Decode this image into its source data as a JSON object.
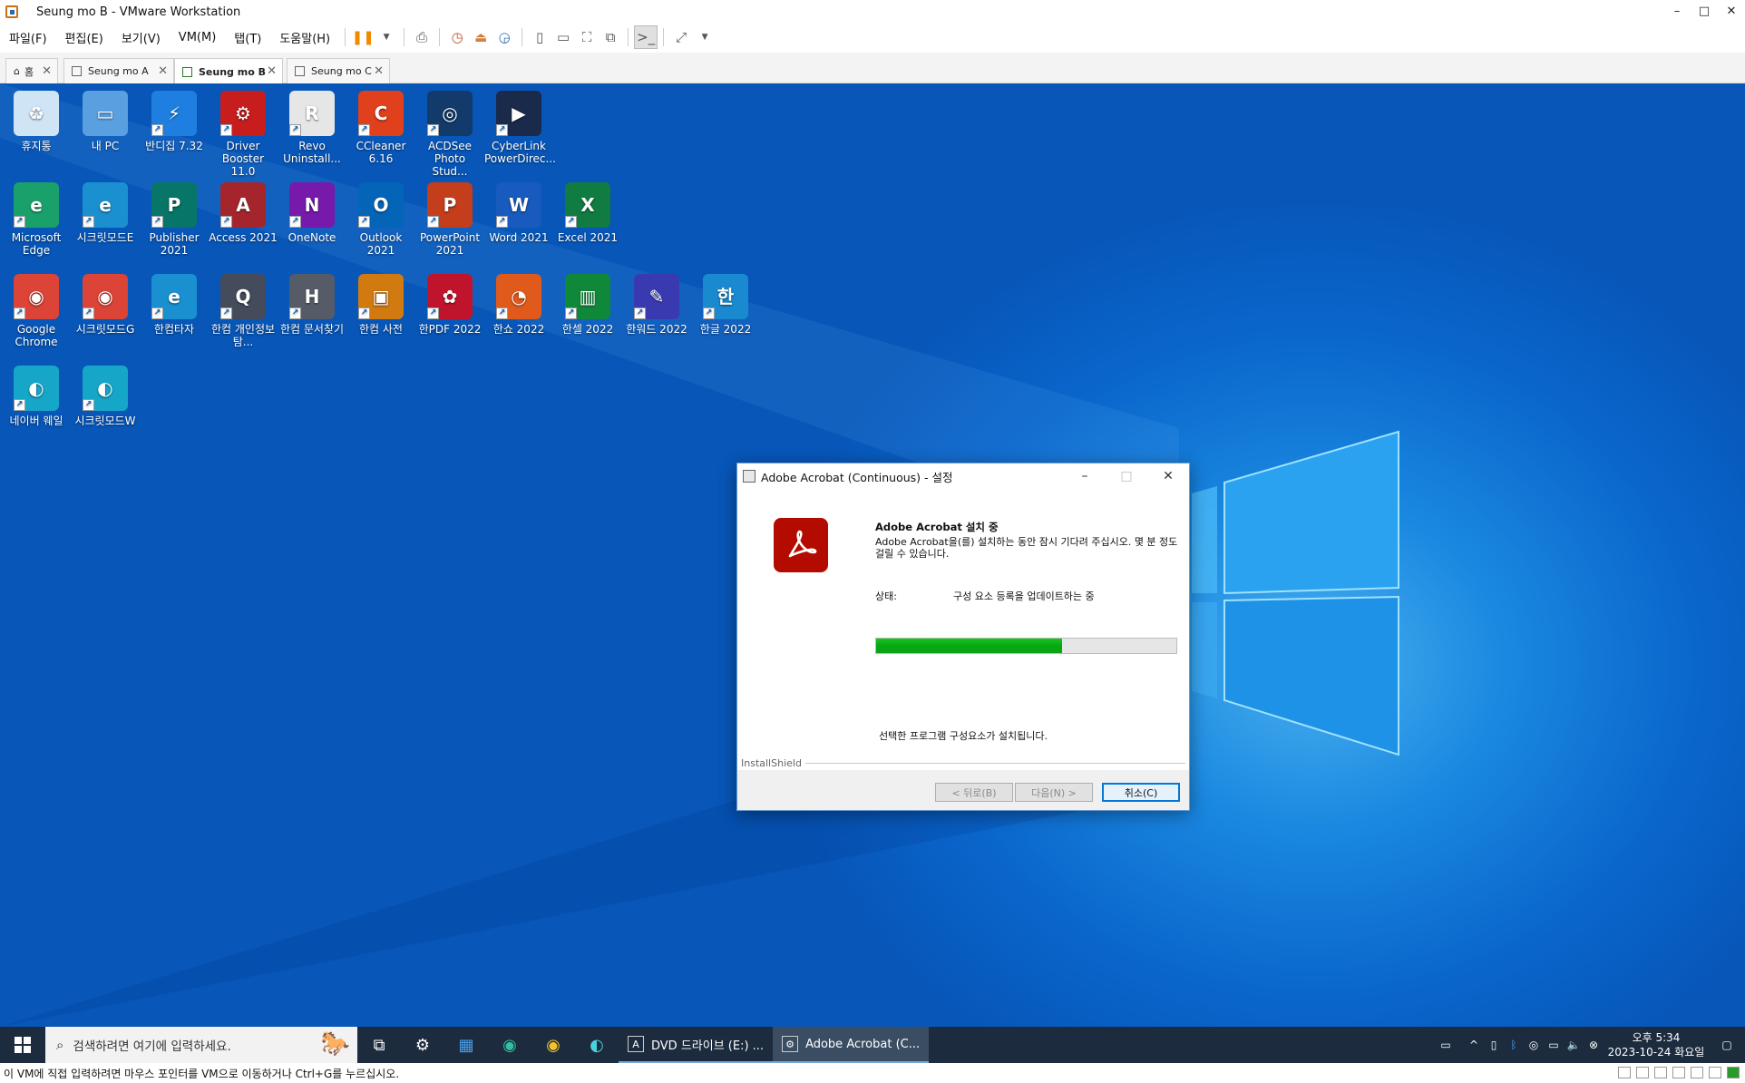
{
  "window": {
    "title": "Seung mo B - VMware Workstation",
    "min": "–",
    "max": "□",
    "close": "✕"
  },
  "menu": [
    "파일(F)",
    "편집(E)",
    "보기(V)",
    "VM(M)",
    "탭(T)",
    "도움말(H)"
  ],
  "tabs": [
    {
      "label": "홈"
    },
    {
      "label": "Seung mo A"
    },
    {
      "label": "Seung mo B"
    },
    {
      "label": "Seung mo C"
    }
  ],
  "desktop_icons": [
    {
      "label": "휴지통",
      "color": "#cfe4f5",
      "glyph": "♻"
    },
    {
      "label": "내 PC",
      "color": "#5aa0e0",
      "glyph": "▭"
    },
    {
      "label": "반디집 7.32",
      "color": "#1f7fe0",
      "glyph": "⚡"
    },
    {
      "label": "Driver Booster 11.0",
      "color": "#c81d1d",
      "glyph": "⚙"
    },
    {
      "label": "Revo Uninstall...",
      "color": "#e6e6e6",
      "glyph": "R"
    },
    {
      "label": "CCleaner 6.16",
      "color": "#e0401c",
      "glyph": "C"
    },
    {
      "label": "ACDSee Photo Stud...",
      "color": "#123a6a",
      "glyph": "◎"
    },
    {
      "label": "CyberLink PowerDirec...",
      "color": "#1a2a4a",
      "glyph": "▶"
    },
    {
      "label": "Microsoft Edge",
      "color": "#1aa06a",
      "glyph": "e"
    },
    {
      "label": "시크릿모드E",
      "color": "#1a90d0",
      "glyph": "e"
    },
    {
      "label": "Publisher 2021",
      "color": "#077568",
      "glyph": "P"
    },
    {
      "label": "Access 2021",
      "color": "#a4262c",
      "glyph": "A"
    },
    {
      "label": "OneNote",
      "color": "#7719aa",
      "glyph": "N"
    },
    {
      "label": "Outlook 2021",
      "color": "#0364b8",
      "glyph": "O"
    },
    {
      "label": "PowerPoint 2021",
      "color": "#c43e1c",
      "glyph": "P"
    },
    {
      "label": "Word 2021",
      "color": "#185abd",
      "glyph": "W"
    },
    {
      "label": "Excel 2021",
      "color": "#107c41",
      "glyph": "X"
    },
    {
      "label": "Google Chrome",
      "color": "#db4437",
      "glyph": "◉"
    },
    {
      "label": "시크릿모드G",
      "color": "#db4437",
      "glyph": "◉"
    },
    {
      "label": "한컴타자",
      "color": "#1a90d0",
      "glyph": "e"
    },
    {
      "label": "한컴 개인정보탐...",
      "color": "#444c5c",
      "glyph": "Q"
    },
    {
      "label": "한컴 문서찾기",
      "color": "#555c68",
      "glyph": "H"
    },
    {
      "label": "한컴 사전",
      "color": "#d07a10",
      "glyph": "▣"
    },
    {
      "label": "한PDF 2022",
      "color": "#c0142c",
      "glyph": "✿"
    },
    {
      "label": "한쇼 2022",
      "color": "#e05a1c",
      "glyph": "◔"
    },
    {
      "label": "한셀 2022",
      "color": "#10883a",
      "glyph": "▥"
    },
    {
      "label": "한워드 2022",
      "color": "#3a3ab0",
      "glyph": "✎"
    },
    {
      "label": "한글 2022",
      "color": "#1a8ad0",
      "glyph": "한"
    },
    {
      "label": "네이버 웨일",
      "color": "#15a6c8",
      "glyph": "◐"
    },
    {
      "label": "시크릿모드W",
      "color": "#15a6c8",
      "glyph": "◐"
    }
  ],
  "dialog": {
    "title": "Adobe Acrobat (Continuous) - 설정",
    "heading": "Adobe Acrobat 설치 중",
    "description": "Adobe Acrobat을(를) 설치하는 동안 잠시 기다려 주십시오. 몇 분 정도 걸릴 수 있습니다.",
    "status_label": "상태:",
    "status_value": "구성 요소 등록을 업데이트하는 중",
    "progress": 0.62,
    "footer": "선택한 프로그램 구성요소가 설치됩니다.",
    "brand": "InstallShield",
    "back": "< 뒤로(B)",
    "next": "다음(N) >",
    "cancel": "취소(C)"
  },
  "taskbar": {
    "search_placeholder": "검색하려면 여기에 입력하세요.",
    "apps": [
      {
        "label": "DVD 드라이브 (E:) ...",
        "active": false
      },
      {
        "label": "Adobe Acrobat (C...",
        "active": true
      }
    ],
    "time": "오후 5:34",
    "date": "2023-10-24 화요일"
  },
  "statusbar": {
    "text": "이 VM에 직접 입력하려면 마우스 포인터를 VM으로 이동하거나 Ctrl+G를 누르십시오."
  }
}
